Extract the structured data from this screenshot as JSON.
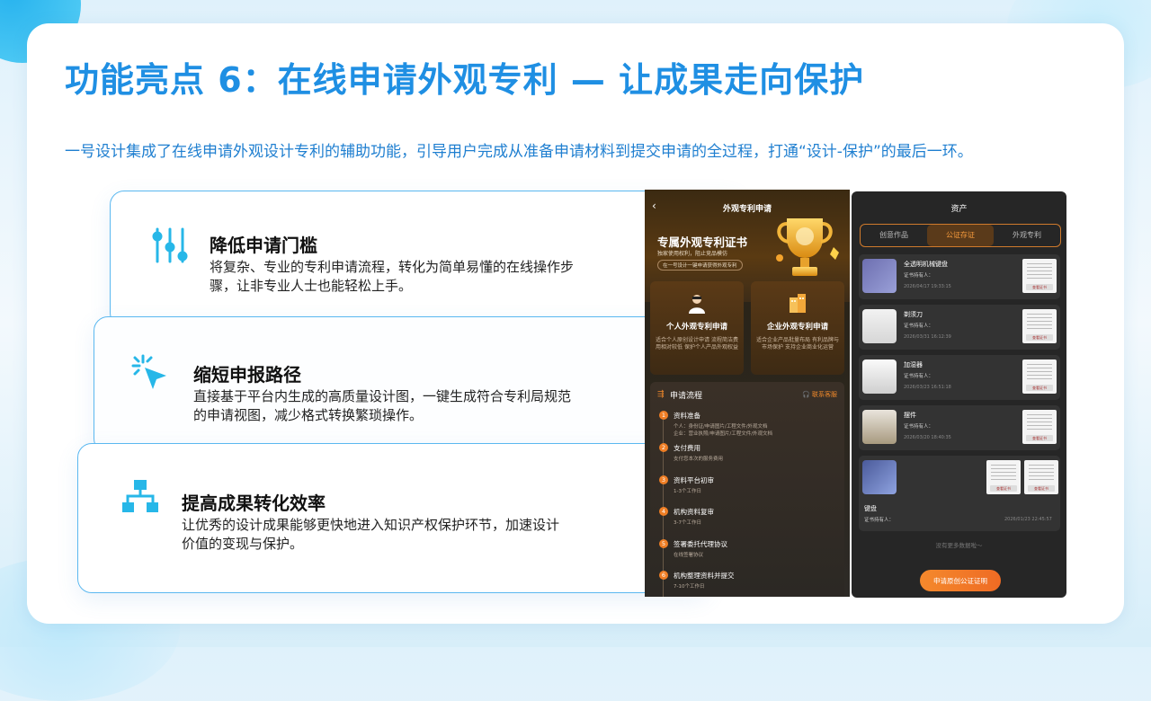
{
  "title": "功能亮点 6：在线申请外观专利 — 让成果走向保护",
  "subtitle": "一号设计集成了在线申请外观设计专利的辅助功能，引导用户完成从准备申请材料到提交申请的全过程，打通“设计-保护”的最后一环。",
  "features": [
    {
      "icon": "sliders-icon",
      "title": "降低申请门槛",
      "desc": "将复杂、专业的专利申请流程，转化为简单易懂的在线操作步骤，让非专业人士也能轻松上手。"
    },
    {
      "icon": "cursor-click-icon",
      "title": "缩短申报路径",
      "desc": "直接基于平台内生成的高质量设计图，一键生成符合专利局规范的申请视图，减少格式转换繁琐操作。"
    },
    {
      "icon": "hierarchy-icon",
      "title": "提高成果转化效率",
      "desc": "让优秀的设计成果能够更快地进入知识产权保护环节，加速设计价值的变现与保护。"
    }
  ],
  "phone1": {
    "header": "外观专利申请",
    "back": "‹",
    "cert_title": "专属外观专利证书",
    "cert_sub": "独家使用权利，阻止竞品模仿",
    "cert_pill": "在一号设计一键申请获得外观专利",
    "boxes": [
      {
        "title": "个人外观专利申请",
        "desc": "适合个人原创设计申请 流程简洁费用相对较低 保护个人产品外观权益"
      },
      {
        "title": "企业外观专利申请",
        "desc": "适合企业产品批量布局 有利品牌与市场保护 支持企业商业化运营"
      }
    ],
    "flow_title": "申请流程",
    "flow_icon": "flow-icon",
    "customer_service": "联系客服",
    "steps": [
      {
        "num": "1",
        "title": "资料准备",
        "desc": [
          "个人：身份证/申请图片/工程文件/外观文档",
          "企业：营业执照/申请图片/工程文件/外观文档"
        ]
      },
      {
        "num": "2",
        "title": "支付费用",
        "desc": [
          "支付您本次的服务费用"
        ]
      },
      {
        "num": "3",
        "title": "资料平台初审",
        "desc": [
          "1-3个工作日"
        ]
      },
      {
        "num": "4",
        "title": "机构资料复审",
        "desc": [
          "3-7个工作日"
        ]
      },
      {
        "num": "5",
        "title": "签署委托代理协议",
        "desc": [
          "在线签署协议"
        ]
      },
      {
        "num": "6",
        "title": "机构整理资料并提交",
        "desc": [
          "7-10个工作日"
        ]
      }
    ]
  },
  "phone2": {
    "header": "资产",
    "tabs": [
      "创意作品",
      "公证存证",
      "外观专利"
    ],
    "active_tab": 1,
    "items": [
      {
        "name": "全透明机械键盘",
        "owner": "证书持有人：",
        "date": "2026/04/17 19:33:15"
      },
      {
        "name": "剃须刀",
        "owner": "证书持有人：",
        "date": "2026/03/31 16:12:39"
      },
      {
        "name": "加湿器",
        "owner": "证书持有人：",
        "date": "2026/03/23 16:51:18"
      },
      {
        "name": "摆件",
        "owner": "证书持有人：",
        "date": "2026/03/20 18:40:35"
      }
    ],
    "cert_btn": "查看证书",
    "keyboard": {
      "name": "键盘",
      "owner": "证书持有人：",
      "date": "2026/01/23 22:45:57"
    },
    "no_more": "没有更多数据啦～",
    "apply_button": "申请原创公证证明",
    "accent": "#f4892c"
  }
}
